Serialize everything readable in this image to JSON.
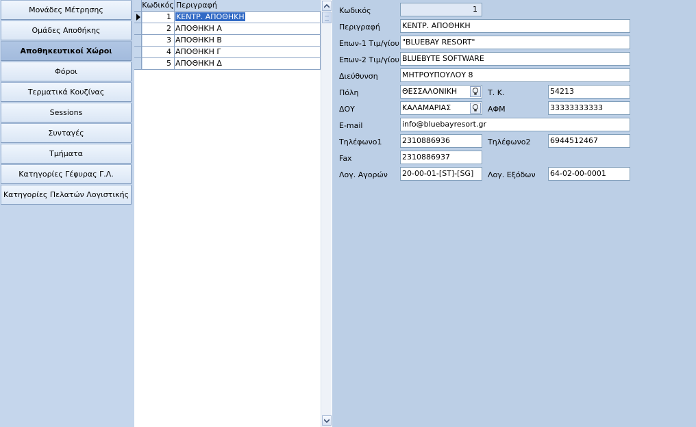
{
  "nav": {
    "items": [
      {
        "label": "Μονάδες Μέτρησης",
        "active": false
      },
      {
        "label": "Ομάδες Αποθήκης",
        "active": false
      },
      {
        "label": "Αποθηκευτικοί Χώροι",
        "active": true
      },
      {
        "label": "Φόροι",
        "active": false
      },
      {
        "label": "Τερματικά Κουζίνας",
        "active": false
      },
      {
        "label": "Sessions",
        "active": false
      },
      {
        "label": "Συνταγές",
        "active": false
      },
      {
        "label": "Τμήματα",
        "active": false
      },
      {
        "label": "Κατηγορίες Γέφυρας Γ.Λ.",
        "active": false
      },
      {
        "label": "Κατηγορίες Πελατών Λογιστικής",
        "active": false
      }
    ]
  },
  "grid": {
    "headers": {
      "code": "Κωδικός",
      "description": "Περιγραφή"
    },
    "rows": [
      {
        "code": "1",
        "description": "ΚΕΝΤΡ. ΑΠΟΘΗΚΗ",
        "selected": true
      },
      {
        "code": "2",
        "description": "ΑΠΟΘΗΚΗ Α",
        "selected": false
      },
      {
        "code": "3",
        "description": "ΑΠΟΘΗΚΗ Β",
        "selected": false
      },
      {
        "code": "4",
        "description": "ΑΠΟΘΗΚΗ Γ",
        "selected": false
      },
      {
        "code": "5",
        "description": "ΑΠΟΘΗΚΗ Δ",
        "selected": false
      }
    ]
  },
  "form": {
    "code": {
      "label": "Κωδικός",
      "value": "1"
    },
    "description": {
      "label": "Περιγραφή",
      "value": "ΚΕΝΤΡ. ΑΠΟΘΗΚΗ"
    },
    "invoice_name1": {
      "label": "Επων-1 Τιμ/γίου",
      "value": "\"BLUEBAY RESORT\""
    },
    "invoice_name2": {
      "label": "Επων-2 Τιμ/γίου",
      "value": "BLUEBYTE SOFTWARE"
    },
    "address": {
      "label": "Διεύθυνση",
      "value": "ΜΗΤΡΟΥΠΟΥΛΟΥ 8"
    },
    "city": {
      "label": "Πόλη",
      "value": "ΘΕΣΣΑΛΟΝΙΚΗ"
    },
    "postal_code": {
      "label": "Τ. Κ.",
      "value": "54213"
    },
    "tax_office": {
      "label": "ΔΟΥ",
      "value": "ΚΑΛΑΜΑΡΙΑΣ"
    },
    "vat_number": {
      "label": "ΑΦΜ",
      "value": "33333333333"
    },
    "email": {
      "label": "E-mail",
      "value": "info@bluebayresort.gr"
    },
    "phone1": {
      "label": "Τηλέφωνο1",
      "value": "2310886936"
    },
    "phone2": {
      "label": "Τηλέφωνο2",
      "value": "6944512467"
    },
    "fax": {
      "label": "Fax",
      "value": "2310886937"
    },
    "purchase_account": {
      "label": "Λογ. Αγορών",
      "value": "20-00-01-[ST]-[SG]"
    },
    "expense_account": {
      "label": "Λογ. Εξόδων",
      "value": "64-02-00-0001"
    }
  },
  "icons": {
    "lookup": "lightbulb-icon",
    "scroll_up": "chevron-up-icon",
    "scroll_down": "chevron-down-icon",
    "row_pointer": "row-pointer-icon"
  }
}
